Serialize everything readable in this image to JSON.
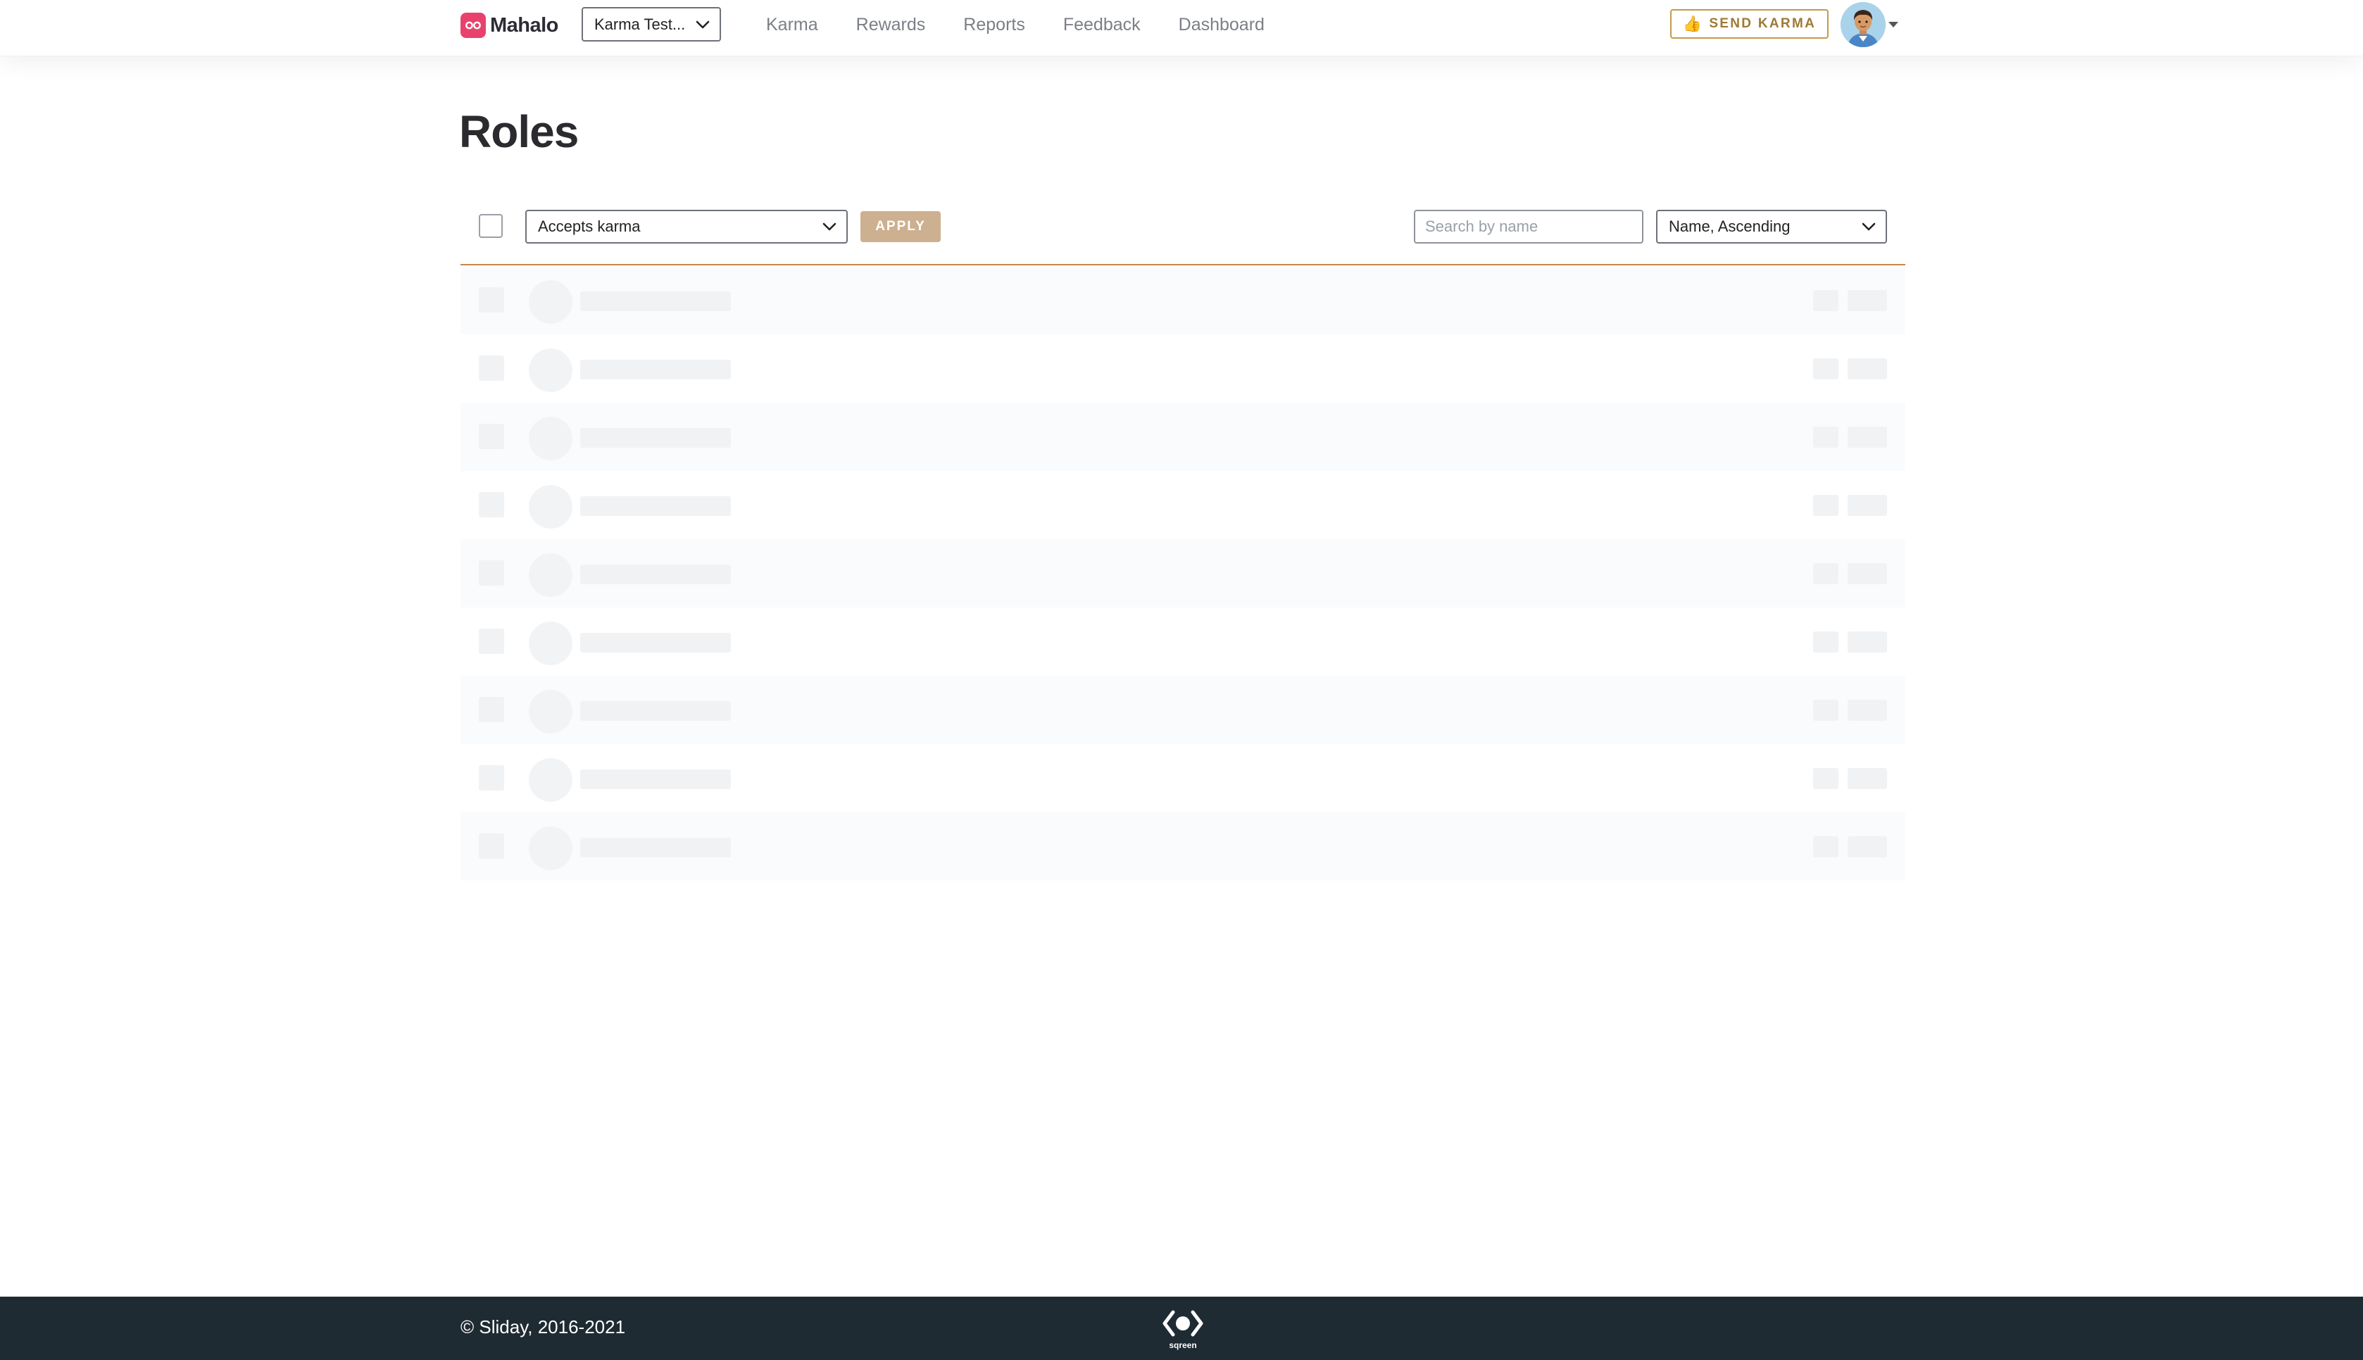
{
  "header": {
    "brand": "Mahalo",
    "org_selector": "Karma Test...",
    "nav": [
      "Karma",
      "Rewards",
      "Reports",
      "Feedback",
      "Dashboard"
    ],
    "send_button": "SEND KARMA"
  },
  "page": {
    "title": "Roles"
  },
  "toolbar": {
    "bulk_action": "Accepts karma",
    "apply_label": "APPLY",
    "search_placeholder": "Search by name",
    "sort": "Name, Ascending"
  },
  "loading_rows": 9,
  "footer": {
    "copyright": "© Sliday, 2016-2021",
    "badge": "sqreen"
  },
  "colors": {
    "brand": "#e8426c",
    "accent": "#c49a4a",
    "apply_button": "#cdb08f",
    "divider": "#c6864a",
    "footer_bg": "#1f2b33"
  }
}
